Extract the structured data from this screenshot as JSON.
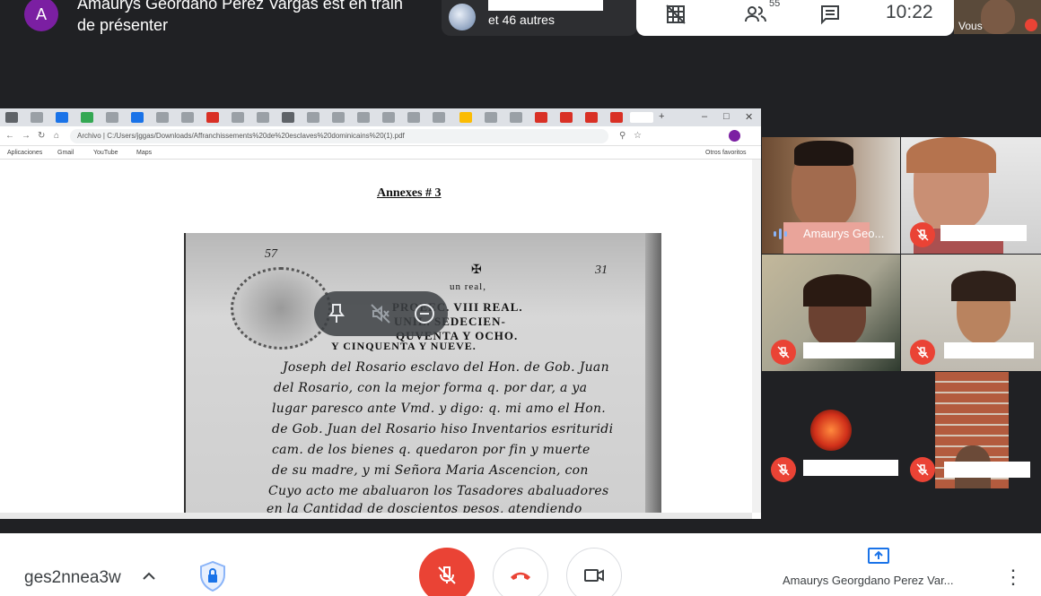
{
  "presenter": {
    "avatar_letter": "A",
    "message": "Amaurys Geordano Perez Vargas est en train de présenter"
  },
  "participants_chip": {
    "others_text": "et 46 autres"
  },
  "status": {
    "participant_count": "55",
    "clock": "10:22"
  },
  "self_tile": {
    "label": "Vous"
  },
  "browser": {
    "url": "Archivo | C:/Users/jggas/Downloads/Affranchissements%20de%20esclaves%20dominicains%20(1).pdf",
    "bookmarks": [
      "Aplicaciones",
      "Gmail",
      "YouTube",
      "Maps",
      "Otros favoritos"
    ]
  },
  "document": {
    "title": "Annexes # 3",
    "page_numbers": [
      "57",
      "31"
    ],
    "printed_lines": [
      "un real,",
      "PROEEC. VIII REAL.",
      "UNIL. SEDECIEN-",
      "QUVENTA Y OCHO.",
      "Y CINQUENTA Y NUEVE."
    ],
    "handwritten_lines": [
      "Joseph del Rosario esclavo del Hon. de Gob. Juan",
      "del Rosario, con la mejor forma q. por dar, a ya",
      "lugar paresco ante Vmd. y digo: q. mi amo el Hon.",
      "de Gob. Juan del Rosario hiso Inventarios esrituridi",
      "cam. de los bienes q. quedaron por fin y muerte",
      "de su madre, y mi Señora Maria Ascencion, con",
      "Cuyo acto me abaluaron los Tasadores abaluadores",
      "en la Cantidad de doscientos pesos, atendiendo"
    ]
  },
  "tiles": [
    {
      "name": "Amaurys Geo..."
    }
  ],
  "bottom": {
    "meeting_code": "ges2nnea3w",
    "presenting_label": "Amaurys Georgdano Perez Var..."
  }
}
